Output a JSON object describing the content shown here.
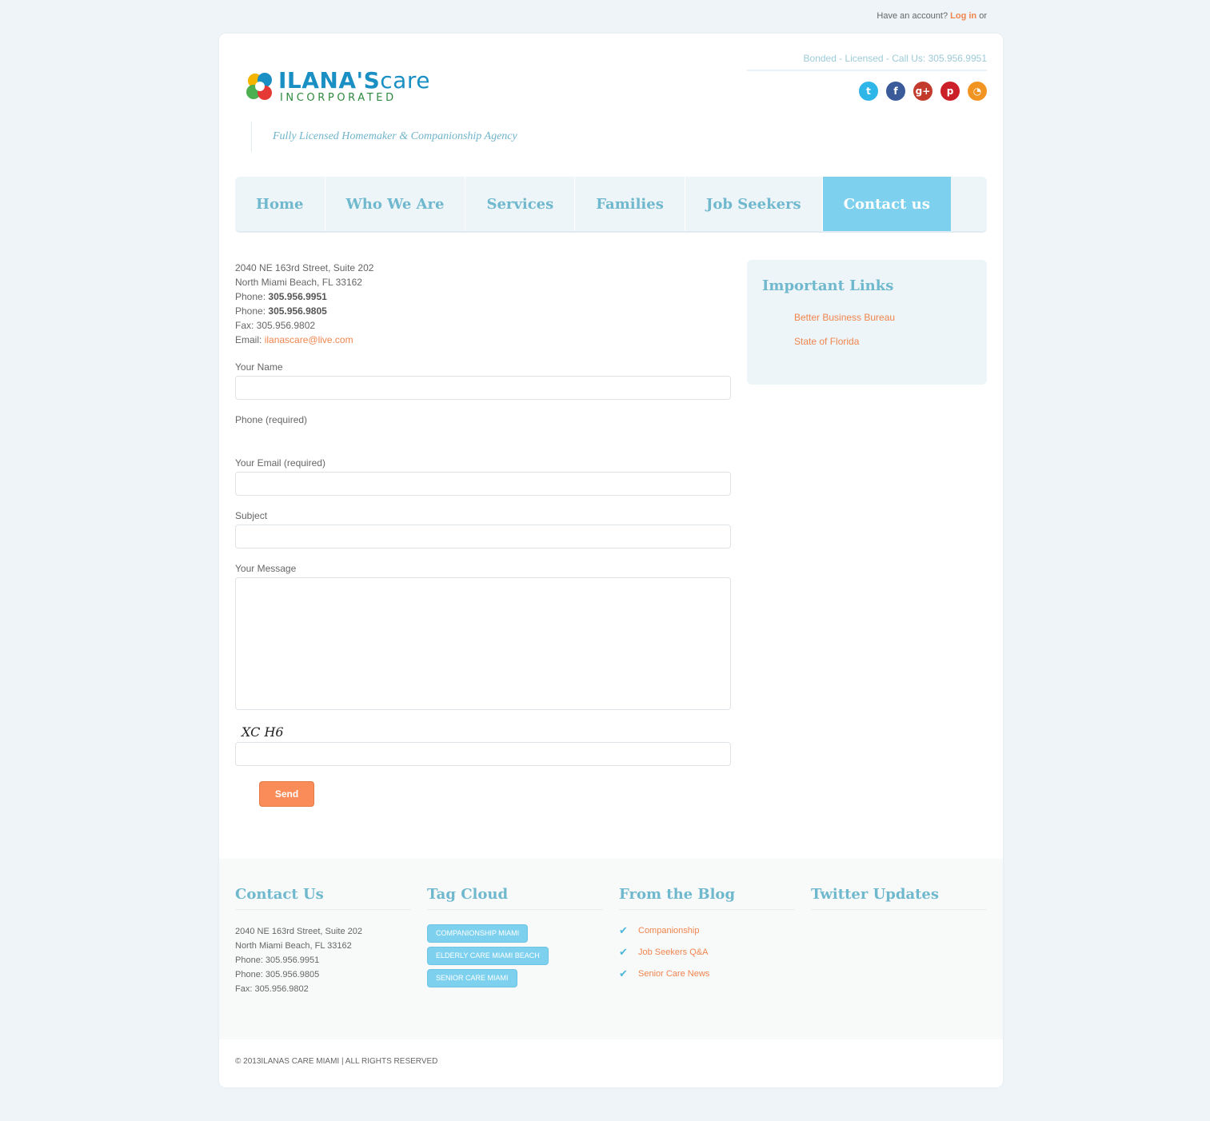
{
  "topbar": {
    "prefix": "Have an account?",
    "login": "Log in",
    "suffix": "or"
  },
  "header": {
    "logo_main": "ILANA'S",
    "logo_care": "care",
    "logo_sub": "INCORPORATED",
    "tagline": "Fully Licensed Homemaker & Companionship Agency",
    "bonded": "Bonded - Licensed - Call Us: 305.956.9951",
    "socials": [
      {
        "icon": "twitter-icon",
        "glyph": "t",
        "color": "#2fb6e8"
      },
      {
        "icon": "facebook-icon",
        "glyph": "f",
        "color": "#3b5a9a"
      },
      {
        "icon": "google-plus-icon",
        "glyph": "g+",
        "color": "#c23b2c"
      },
      {
        "icon": "pinterest-icon",
        "glyph": "p",
        "color": "#cb2027"
      },
      {
        "icon": "rss-icon",
        "glyph": "◔",
        "color": "#f29422"
      }
    ]
  },
  "nav": {
    "items": [
      "Home",
      "Who We Are",
      "Services",
      "Families",
      "Job Seekers",
      "Contact us"
    ],
    "active": "Contact us"
  },
  "contact": {
    "address1": "2040 NE 163rd Street, Suite 202",
    "address2": "North Miami Beach, FL 33162",
    "phone_label": "Phone:",
    "phone1": "305.956.9951",
    "phone2": "305.956.9805",
    "fax": "Fax: 305.956.9802",
    "email_label": "Email:",
    "email": "ilanascare@live.com"
  },
  "form": {
    "name_label": "Your Name",
    "phone_label": "Phone (required)",
    "email_label": "Your Email (required)",
    "subject_label": "Subject",
    "message_label": "Your Message",
    "captcha": "XC H6",
    "send": "Send"
  },
  "sidebar": {
    "title": "Important Links",
    "links": [
      "Better Business Bureau",
      "State of Florida"
    ]
  },
  "footer": {
    "contact_title": "Contact Us",
    "contact_lines": [
      "2040 NE 163rd Street, Suite 202",
      "North Miami Beach, FL 33162",
      "Phone: 305.956.9951",
      "Phone: 305.956.9805",
      "Fax: 305.956.9802"
    ],
    "tag_title": "Tag Cloud",
    "tags": [
      "COMPANIONSHIP MIAMI",
      "ELDERLY CARE MIAMI BEACH",
      "SENIOR CARE MIAMI"
    ],
    "blog_title": "From the Blog",
    "blog_items": [
      "Companionship",
      "Job Seekers Q&A",
      "Senior Care News"
    ],
    "twitter_title": "Twitter Updates"
  },
  "copyright": "© 2013ILANAS CARE MIAMI | ALL RIGHTS RESERVED",
  "colors": {
    "accent": "#7ed1ee",
    "link": "#f0854e",
    "heading": "#6fb8cd"
  }
}
